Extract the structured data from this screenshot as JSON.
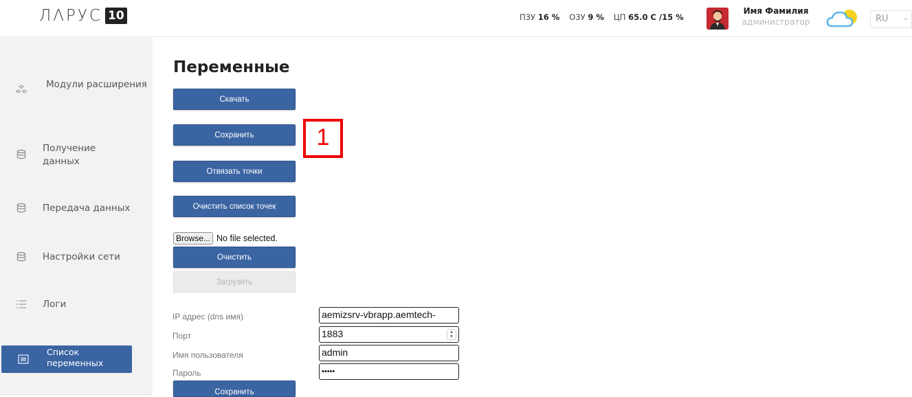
{
  "header": {
    "logo_text": "ЛΛРУС",
    "logo_badge": "10",
    "stats": [
      {
        "label": "ПЗУ",
        "value": "16 %"
      },
      {
        "label": "ОЗУ",
        "value": "9 %"
      },
      {
        "label": "ЦП",
        "value": "65.0 С /15 %"
      }
    ],
    "user": {
      "name": "Имя Фамилия",
      "role": "администратор"
    },
    "language": "RU"
  },
  "sidebar": {
    "items": [
      {
        "label": "Модули расширения",
        "icon": "modules-icon"
      },
      {
        "label": "Получение данных",
        "icon": "database-icon"
      },
      {
        "label": "Передача данных",
        "icon": "database-icon"
      },
      {
        "label": "Настройки сети",
        "icon": "database-icon"
      },
      {
        "label": "Логи",
        "icon": "list-icon"
      },
      {
        "label": "Список переменных",
        "icon": "variables-icon",
        "active": true
      }
    ]
  },
  "main": {
    "title": "Переменные",
    "buttons": {
      "download": "Скачать",
      "save": "Сохранить",
      "unbind": "Отвязать точки",
      "clear_points": "Очистить список точек",
      "clear": "Очистить",
      "upload": "Загрузить",
      "save_bottom": "Сохранить"
    },
    "marker": "1",
    "file": {
      "browse": "Browse...",
      "status": "No file selected."
    },
    "form": {
      "ip_label": "IP адрес (dns имя)",
      "ip_value": "aemizsrv-vbrapp.aemtech-",
      "port_label": "Порт",
      "port_value": "1883",
      "user_label": "Имя пользователя",
      "user_value": "admin",
      "password_label": "Пароль",
      "password_value": "•••••"
    }
  },
  "colors": {
    "accent": "#3b64a3",
    "marker": "#ee0000",
    "sidebar_bg": "#f2f2f2"
  }
}
